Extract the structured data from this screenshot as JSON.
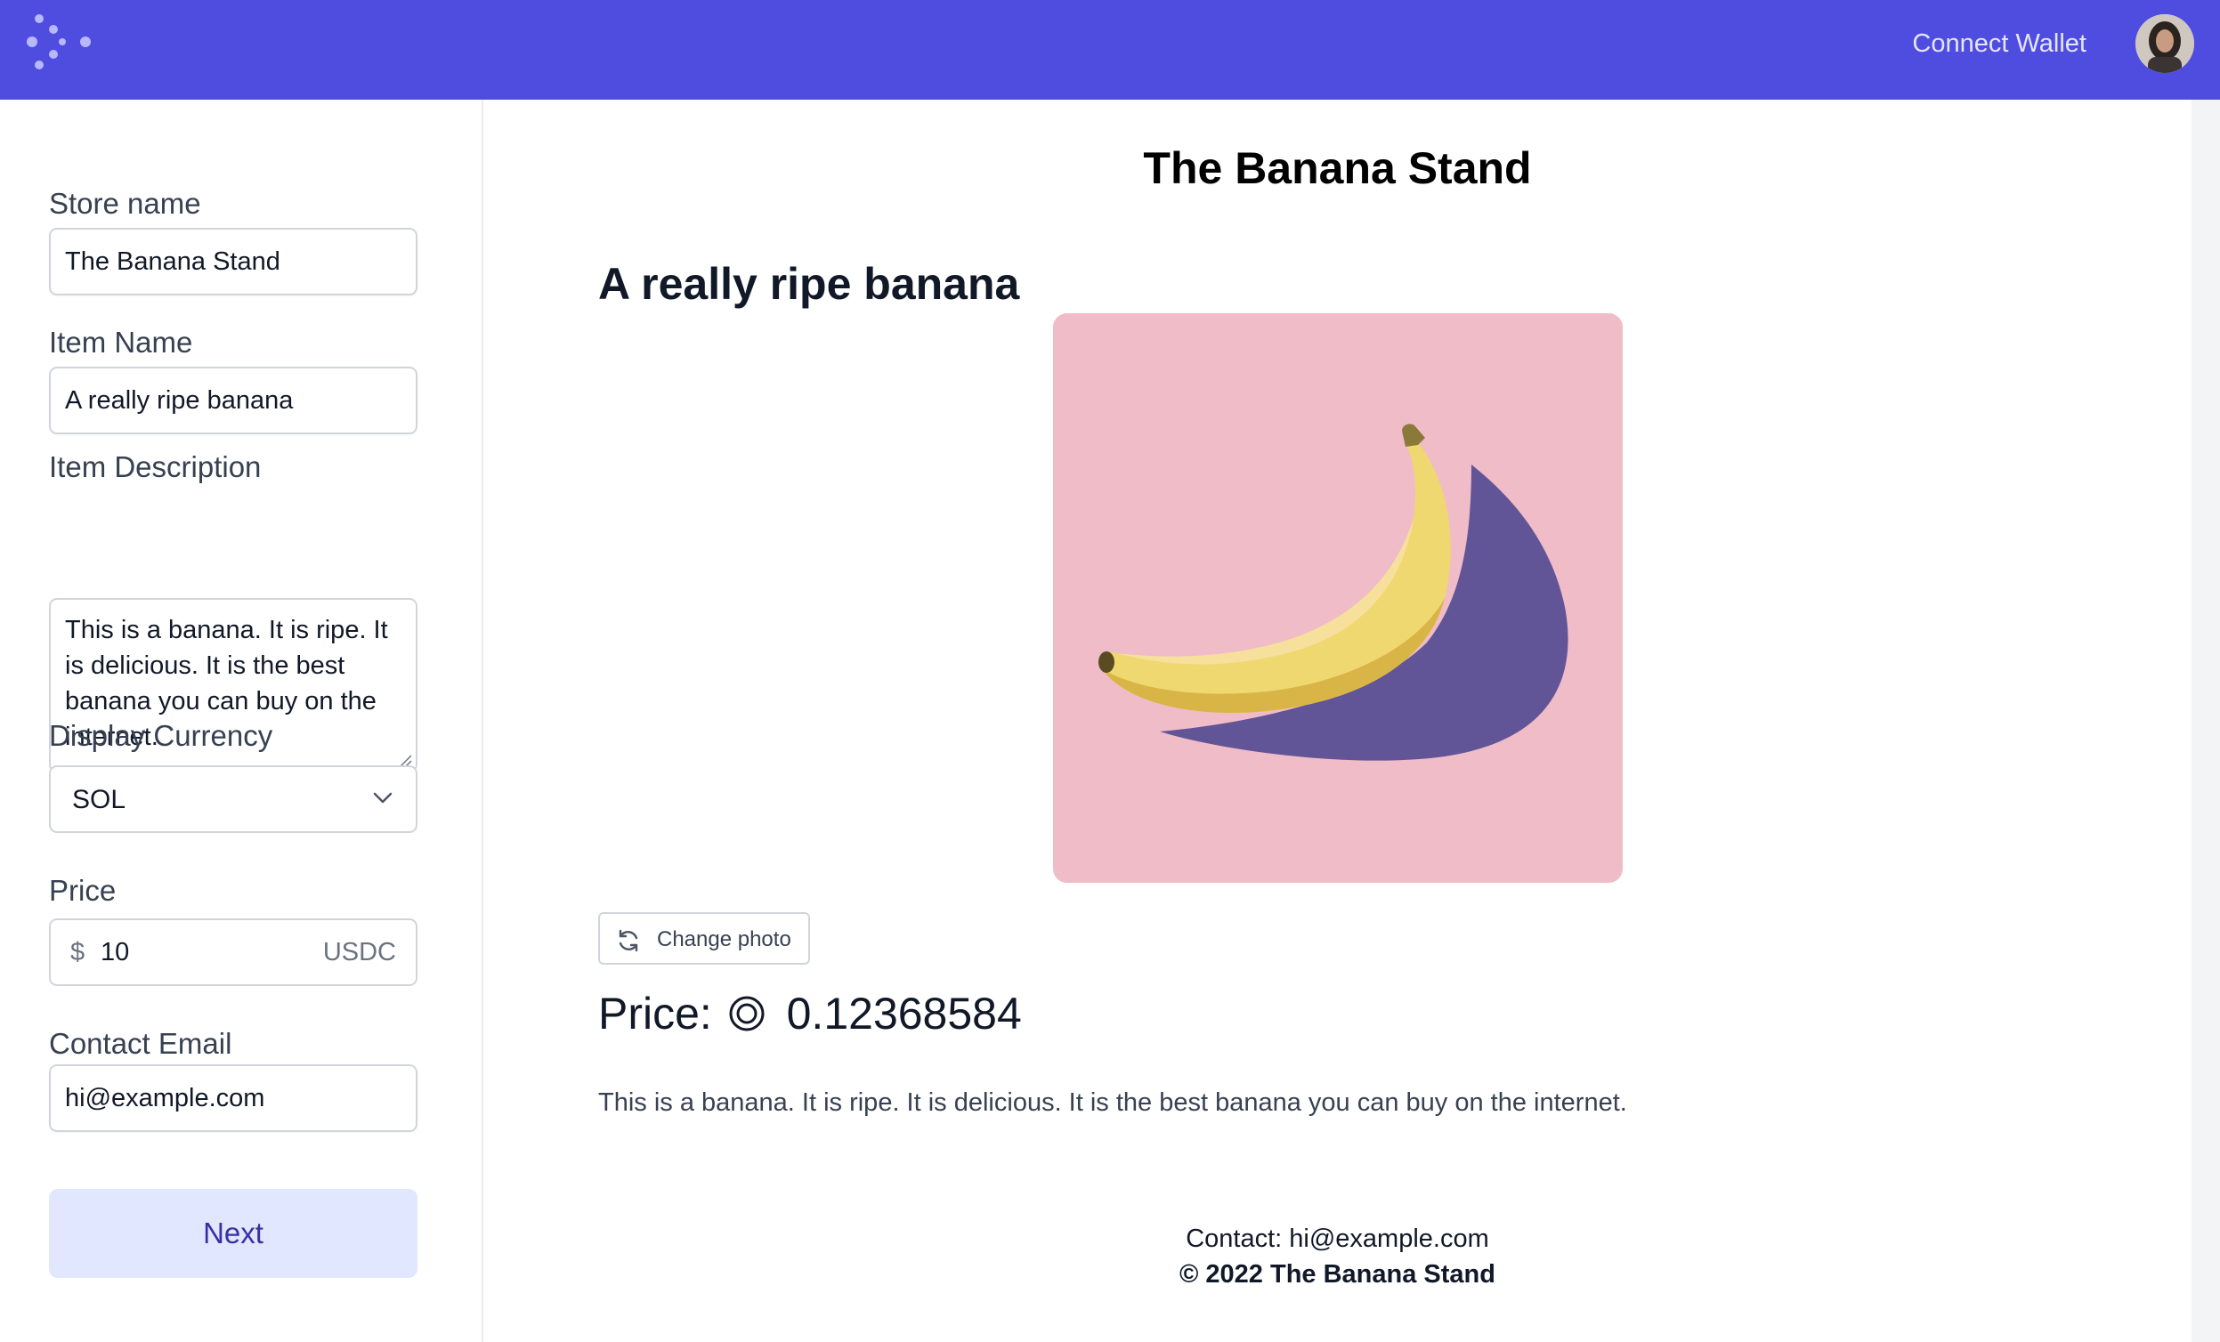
{
  "header": {
    "connect_wallet_label": "Connect Wallet",
    "logo_icon": "dots-logo-icon",
    "avatar_icon": "user-avatar"
  },
  "form": {
    "store_name": {
      "label": "Store name",
      "value": "The Banana Stand"
    },
    "item_name": {
      "label": "Item Name",
      "value": "A really ripe banana"
    },
    "item_description": {
      "label": "Item Description",
      "value": "This is a banana. It is ripe. It is delicious. It is the best banana you can buy on the internet."
    },
    "display_currency": {
      "label": "Display Currency",
      "selected": "SOL"
    },
    "price": {
      "label": "Price",
      "prefix": "$",
      "value": "10",
      "suffix": "USDC"
    },
    "contact_email": {
      "label": "Contact Email",
      "value": "hi@example.com"
    },
    "next_label": "Next"
  },
  "preview": {
    "store_title": "The Banana Stand",
    "item_title": "A really ripe banana",
    "change_photo_label": "Change photo",
    "price_label": "Price:",
    "price_amount": "0.12368584",
    "description": "This is a banana. It is ripe. It is delicious. It is the best banana you can buy on the internet.",
    "footer_contact": "Contact: hi@example.com",
    "footer_copyright": "© 2022 The Banana Stand"
  },
  "colors": {
    "header_bg": "#4f4ddf",
    "image_bg": "#efbcc7",
    "next_button_bg": "#e0e7ff",
    "next_button_text": "#3730a3"
  }
}
